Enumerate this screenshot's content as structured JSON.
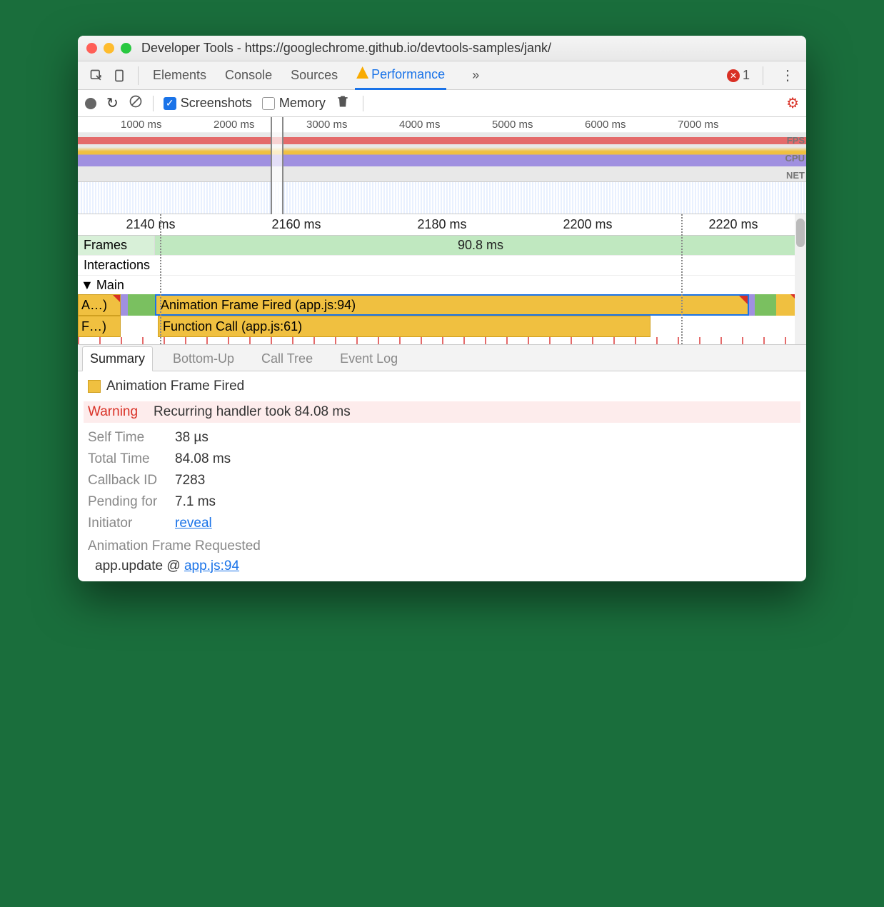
{
  "window": {
    "title": "Developer Tools - https://googlechrome.github.io/devtools-samples/jank/"
  },
  "tabs": {
    "items": [
      "Elements",
      "Console",
      "Sources",
      "Performance"
    ],
    "active": "Performance",
    "more": "»",
    "error_count": "1"
  },
  "toolbar": {
    "screenshots_label": "Screenshots",
    "memory_label": "Memory"
  },
  "overview_ruler": [
    "1000 ms",
    "2000 ms",
    "3000 ms",
    "4000 ms",
    "5000 ms",
    "6000 ms",
    "7000 ms"
  ],
  "overview_rows": {
    "fps": "FPS",
    "cpu": "CPU",
    "net": "NET"
  },
  "zoom_ruler": [
    "2140 ms",
    "2160 ms",
    "2180 ms",
    "2200 ms",
    "2220 ms"
  ],
  "tracks": {
    "frames": {
      "label": "Frames",
      "value": "90.8 ms"
    },
    "interactions": {
      "label": "Interactions"
    },
    "main": {
      "label": "Main",
      "row1_stub": "A…)",
      "row1_bar": "Animation Frame Fired (app.js:94)",
      "row2_stub": "F…)",
      "row2_bar": "Function Call (app.js:61)"
    }
  },
  "bottom_tabs": [
    "Summary",
    "Bottom-Up",
    "Call Tree",
    "Event Log"
  ],
  "summary": {
    "title": "Animation Frame Fired",
    "warning_label": "Warning",
    "warning_text": "Recurring handler took 84.08 ms",
    "rows": {
      "self_time_k": "Self Time",
      "self_time_v": "38 µs",
      "total_time_k": "Total Time",
      "total_time_v": "84.08 ms",
      "callback_k": "Callback ID",
      "callback_v": "7283",
      "pending_k": "Pending for",
      "pending_v": "7.1 ms",
      "initiator_k": "Initiator",
      "initiator_v": "reveal"
    },
    "sub": "Animation Frame Requested",
    "stack_fn": "app.update @ ",
    "stack_link": "app.js:94"
  }
}
